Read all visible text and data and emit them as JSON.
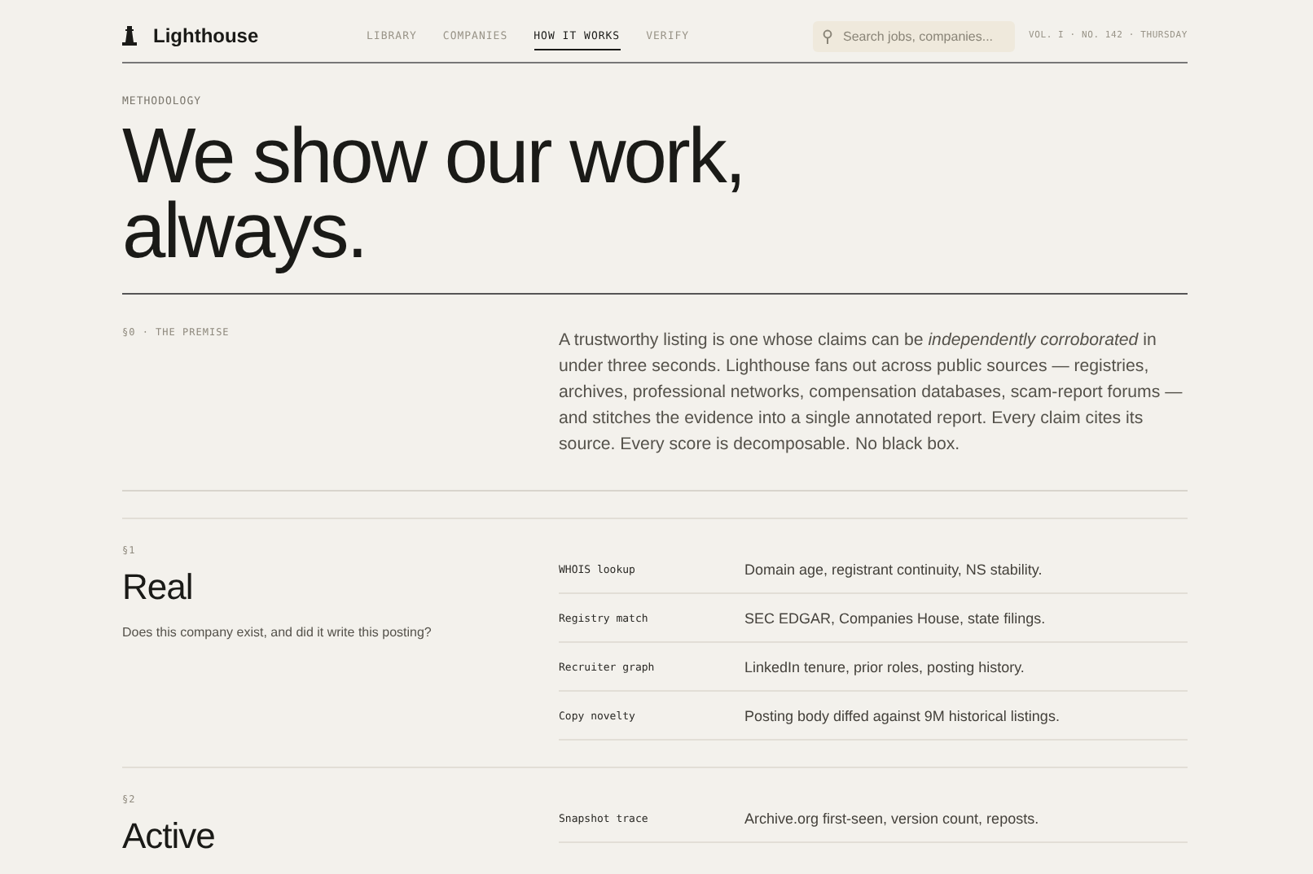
{
  "brand": "Lighthouse",
  "nav": [
    {
      "label": "LIBRARY",
      "selected": false
    },
    {
      "label": "COMPANIES",
      "selected": false
    },
    {
      "label": "HOW IT WORKS",
      "selected": true
    },
    {
      "label": "VERIFY",
      "selected": false
    }
  ],
  "search": {
    "placeholder": "Search jobs, companies..."
  },
  "issue": "VOL. I · NO. 142 · THURSDAY",
  "eyebrow": "METHODOLOGY",
  "headline": [
    "We show our work,",
    "always."
  ],
  "premise": {
    "label": "§0 · THE PREMISE",
    "text": "A trustworthy listing is one whose claims can be *independently corroborated* in under three seconds. Lighthouse fans out across public sources — registries, archives, professional networks, compensation databases, scam-report forums — and stitches the evidence into a single annotated report. Every claim cites its source. Every score is decomposable. No black box."
  },
  "sections": [
    {
      "number": "§1",
      "title": "Real",
      "question": "Does this company exist, and did it write this posting?",
      "checks": [
        {
          "name": "WHOIS lookup",
          "detail": "Domain age, registrant continuity, NS stability."
        },
        {
          "name": "Registry match",
          "detail": "SEC EDGAR, Companies House, state filings."
        },
        {
          "name": "Recruiter graph",
          "detail": "LinkedIn tenure, prior roles, posting history."
        },
        {
          "name": "Copy novelty",
          "detail": "Posting body diffed against 9M historical listings."
        }
      ]
    },
    {
      "number": "§2",
      "title": "Active",
      "checks": [
        {
          "name": "Snapshot trace",
          "detail": "Archive.org first-seen, version count, reposts."
        }
      ]
    }
  ]
}
